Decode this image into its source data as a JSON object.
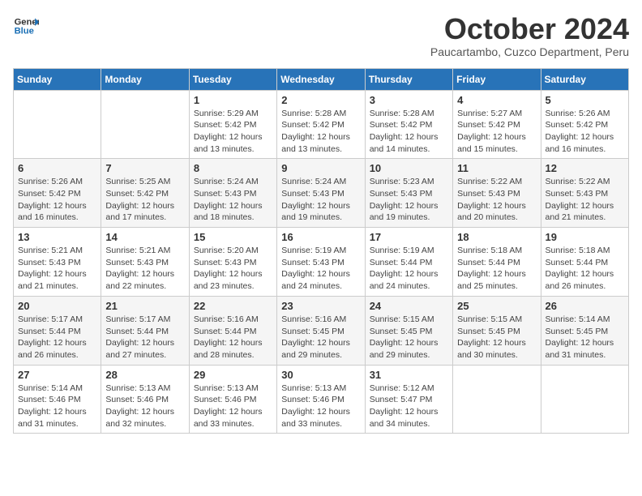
{
  "logo": {
    "line1": "General",
    "line2": "Blue"
  },
  "title": "October 2024",
  "subtitle": "Paucartambo, Cuzco Department, Peru",
  "header_days": [
    "Sunday",
    "Monday",
    "Tuesday",
    "Wednesday",
    "Thursday",
    "Friday",
    "Saturday"
  ],
  "weeks": [
    [
      {
        "day": "",
        "info": ""
      },
      {
        "day": "",
        "info": ""
      },
      {
        "day": "1",
        "info": "Sunrise: 5:29 AM\nSunset: 5:42 PM\nDaylight: 12 hours and 13 minutes."
      },
      {
        "day": "2",
        "info": "Sunrise: 5:28 AM\nSunset: 5:42 PM\nDaylight: 12 hours and 13 minutes."
      },
      {
        "day": "3",
        "info": "Sunrise: 5:28 AM\nSunset: 5:42 PM\nDaylight: 12 hours and 14 minutes."
      },
      {
        "day": "4",
        "info": "Sunrise: 5:27 AM\nSunset: 5:42 PM\nDaylight: 12 hours and 15 minutes."
      },
      {
        "day": "5",
        "info": "Sunrise: 5:26 AM\nSunset: 5:42 PM\nDaylight: 12 hours and 16 minutes."
      }
    ],
    [
      {
        "day": "6",
        "info": "Sunrise: 5:26 AM\nSunset: 5:42 PM\nDaylight: 12 hours and 16 minutes."
      },
      {
        "day": "7",
        "info": "Sunrise: 5:25 AM\nSunset: 5:42 PM\nDaylight: 12 hours and 17 minutes."
      },
      {
        "day": "8",
        "info": "Sunrise: 5:24 AM\nSunset: 5:43 PM\nDaylight: 12 hours and 18 minutes."
      },
      {
        "day": "9",
        "info": "Sunrise: 5:24 AM\nSunset: 5:43 PM\nDaylight: 12 hours and 19 minutes."
      },
      {
        "day": "10",
        "info": "Sunrise: 5:23 AM\nSunset: 5:43 PM\nDaylight: 12 hours and 19 minutes."
      },
      {
        "day": "11",
        "info": "Sunrise: 5:22 AM\nSunset: 5:43 PM\nDaylight: 12 hours and 20 minutes."
      },
      {
        "day": "12",
        "info": "Sunrise: 5:22 AM\nSunset: 5:43 PM\nDaylight: 12 hours and 21 minutes."
      }
    ],
    [
      {
        "day": "13",
        "info": "Sunrise: 5:21 AM\nSunset: 5:43 PM\nDaylight: 12 hours and 21 minutes."
      },
      {
        "day": "14",
        "info": "Sunrise: 5:21 AM\nSunset: 5:43 PM\nDaylight: 12 hours and 22 minutes."
      },
      {
        "day": "15",
        "info": "Sunrise: 5:20 AM\nSunset: 5:43 PM\nDaylight: 12 hours and 23 minutes."
      },
      {
        "day": "16",
        "info": "Sunrise: 5:19 AM\nSunset: 5:43 PM\nDaylight: 12 hours and 24 minutes."
      },
      {
        "day": "17",
        "info": "Sunrise: 5:19 AM\nSunset: 5:44 PM\nDaylight: 12 hours and 24 minutes."
      },
      {
        "day": "18",
        "info": "Sunrise: 5:18 AM\nSunset: 5:44 PM\nDaylight: 12 hours and 25 minutes."
      },
      {
        "day": "19",
        "info": "Sunrise: 5:18 AM\nSunset: 5:44 PM\nDaylight: 12 hours and 26 minutes."
      }
    ],
    [
      {
        "day": "20",
        "info": "Sunrise: 5:17 AM\nSunset: 5:44 PM\nDaylight: 12 hours and 26 minutes."
      },
      {
        "day": "21",
        "info": "Sunrise: 5:17 AM\nSunset: 5:44 PM\nDaylight: 12 hours and 27 minutes."
      },
      {
        "day": "22",
        "info": "Sunrise: 5:16 AM\nSunset: 5:44 PM\nDaylight: 12 hours and 28 minutes."
      },
      {
        "day": "23",
        "info": "Sunrise: 5:16 AM\nSunset: 5:45 PM\nDaylight: 12 hours and 29 minutes."
      },
      {
        "day": "24",
        "info": "Sunrise: 5:15 AM\nSunset: 5:45 PM\nDaylight: 12 hours and 29 minutes."
      },
      {
        "day": "25",
        "info": "Sunrise: 5:15 AM\nSunset: 5:45 PM\nDaylight: 12 hours and 30 minutes."
      },
      {
        "day": "26",
        "info": "Sunrise: 5:14 AM\nSunset: 5:45 PM\nDaylight: 12 hours and 31 minutes."
      }
    ],
    [
      {
        "day": "27",
        "info": "Sunrise: 5:14 AM\nSunset: 5:46 PM\nDaylight: 12 hours and 31 minutes."
      },
      {
        "day": "28",
        "info": "Sunrise: 5:13 AM\nSunset: 5:46 PM\nDaylight: 12 hours and 32 minutes."
      },
      {
        "day": "29",
        "info": "Sunrise: 5:13 AM\nSunset: 5:46 PM\nDaylight: 12 hours and 33 minutes."
      },
      {
        "day": "30",
        "info": "Sunrise: 5:13 AM\nSunset: 5:46 PM\nDaylight: 12 hours and 33 minutes."
      },
      {
        "day": "31",
        "info": "Sunrise: 5:12 AM\nSunset: 5:47 PM\nDaylight: 12 hours and 34 minutes."
      },
      {
        "day": "",
        "info": ""
      },
      {
        "day": "",
        "info": ""
      }
    ]
  ]
}
